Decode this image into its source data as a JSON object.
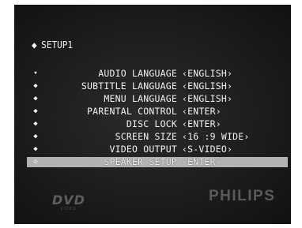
{
  "menu": {
    "title": "SETUP1",
    "items": [
      {
        "label": "AUDIO LANGUAGE",
        "value": "‹ENGLISH›",
        "bullet": "▾"
      },
      {
        "label": "SUBTITLE LANGUAGE",
        "value": "‹ENGLISH›",
        "bullet": "◆"
      },
      {
        "label": "MENU LANGUAGE",
        "value": "‹ENGLISH›",
        "bullet": "◆"
      },
      {
        "label": "PARENTAL CONTROL",
        "value": "‹ENTER›",
        "bullet": "◆"
      },
      {
        "label": "DISC LOCK",
        "value": "‹ENTER›",
        "bullet": "◆"
      },
      {
        "label": "SCREEN SIZE",
        "value": "‹16 :9 WIDE›",
        "bullet": "◆"
      },
      {
        "label": "VIDEO OUTPUT",
        "value": "‹S-VIDEO›",
        "bullet": "◆"
      },
      {
        "label": "SPEAKER SETUP",
        "value": "‹ENTER›",
        "bullet": "◇"
      }
    ],
    "title_bullet": "◆",
    "selected_color": "#b2b2b2"
  },
  "logos": {
    "dvd": "DVD",
    "dvd_sub": "VIDEO",
    "brand": "PHILIPS"
  }
}
